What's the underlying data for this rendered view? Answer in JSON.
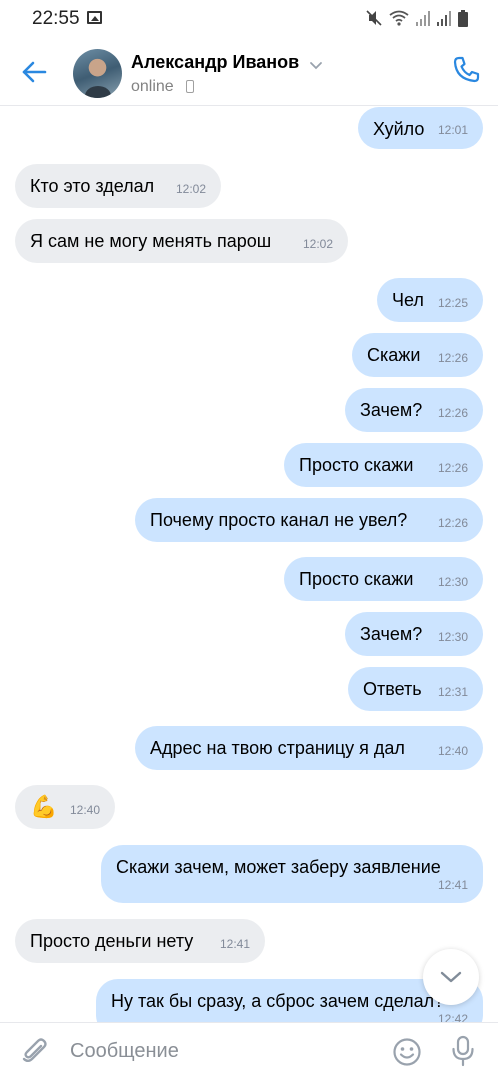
{
  "status_bar": {
    "time": "22:55"
  },
  "header": {
    "contact_name": "Александр Иванов",
    "status": "online"
  },
  "messages": [
    {
      "dir": "out",
      "text": "Хуйло",
      "time": "12:01"
    },
    {
      "dir": "in",
      "text": "Кто это зделал",
      "time": "12:02"
    },
    {
      "dir": "in",
      "text": "Я сам не могу менять парош",
      "time": "12:02"
    },
    {
      "dir": "out",
      "text": "Чел",
      "time": "12:25"
    },
    {
      "dir": "out",
      "text": "Скажи",
      "time": "12:26"
    },
    {
      "dir": "out",
      "text": "Зачем?",
      "time": "12:26"
    },
    {
      "dir": "out",
      "text": "Просто скажи",
      "time": "12:26"
    },
    {
      "dir": "out",
      "text": "Почему просто канал не увел?",
      "time": "12:26"
    },
    {
      "dir": "out",
      "text": "Просто скажи",
      "time": "12:30"
    },
    {
      "dir": "out",
      "text": "Зачем?",
      "time": "12:30"
    },
    {
      "dir": "out",
      "text": "Ответь",
      "time": "12:31"
    },
    {
      "dir": "out",
      "text": "Адрес на твою страницу я дал",
      "time": "12:40"
    },
    {
      "dir": "in",
      "text": "💪",
      "time": "12:40"
    },
    {
      "dir": "out",
      "text": "Скажи зачем, может заберу заявление",
      "time": "12:41"
    },
    {
      "dir": "in",
      "text": "Просто деньги нету",
      "time": "12:41"
    },
    {
      "dir": "out",
      "text": "Ну так бы сразу, а сброс зачем сделал?",
      "time": "12:42"
    }
  ],
  "composer": {
    "placeholder": "Сообщение"
  },
  "colors": {
    "outgoing_bubble": "#cce4ff",
    "incoming_bubble": "#ebedf0",
    "accent": "#2a88e0"
  }
}
